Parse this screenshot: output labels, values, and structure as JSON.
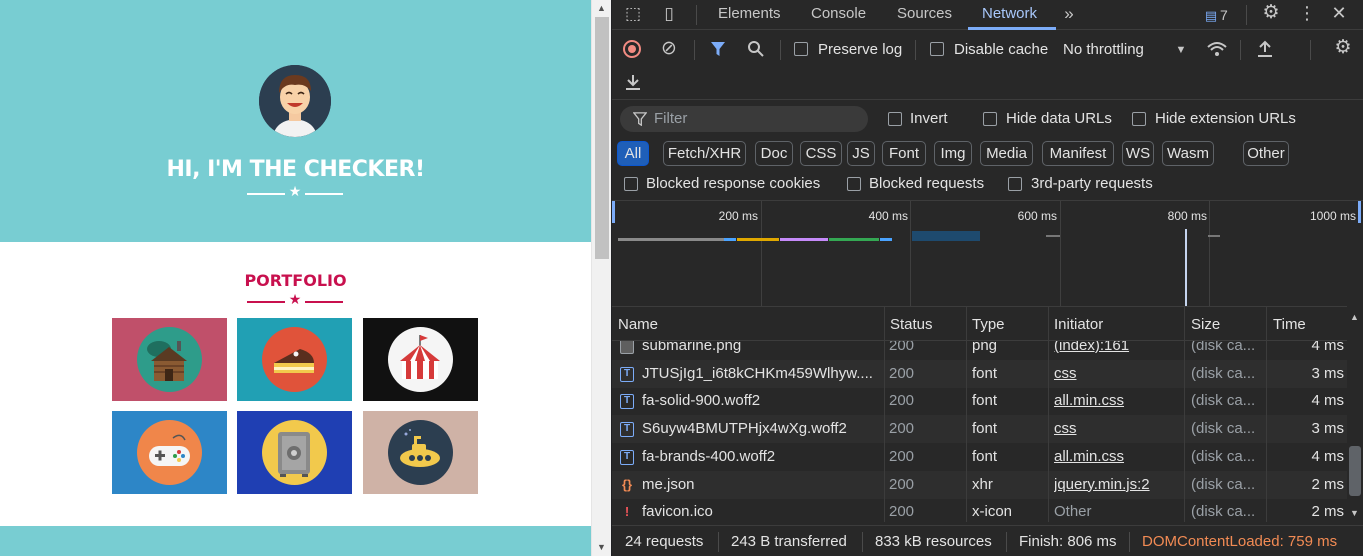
{
  "page": {
    "hero_title": "HI, I'M THE CHECKER!",
    "portfolio_title": "PORTFOLIO",
    "tiles": [
      {
        "name": "cabin",
        "bg": "#c0506a",
        "circle": "#2e9c8a"
      },
      {
        "name": "cake",
        "bg": "#21a0b4",
        "circle": "#e0533a"
      },
      {
        "name": "circus-tent",
        "bg": "#111111",
        "circle": "#f5f5f5"
      },
      {
        "name": "game-controller",
        "bg": "#2d86c7",
        "circle": "#f0864a"
      },
      {
        "name": "safe",
        "bg": "#1f3fb3",
        "circle": "#f2c94c"
      },
      {
        "name": "submarine",
        "bg": "#cfb2a6",
        "circle": "#2c3e50"
      }
    ],
    "colors": {
      "hero": "#78cdd2",
      "accent": "#c8104e"
    }
  },
  "devtools": {
    "tabs": [
      "Elements",
      "Console",
      "Sources",
      "Network"
    ],
    "active_tab": "Network",
    "issues_count": "7",
    "toolbar": {
      "preserve_log": "Preserve log",
      "disable_cache": "Disable cache",
      "throttling": "No throttling"
    },
    "filter": {
      "placeholder": "Filter",
      "invert": "Invert",
      "hide_data_urls": "Hide data URLs",
      "hide_extension_urls": "Hide extension URLs"
    },
    "type_chips": [
      "All",
      "Fetch/XHR",
      "Doc",
      "CSS",
      "JS",
      "Font",
      "Img",
      "Media",
      "Manifest",
      "WS",
      "Wasm",
      "Other"
    ],
    "active_chip": "All",
    "blocked": {
      "cookies": "Blocked response cookies",
      "requests": "Blocked requests",
      "third_party": "3rd-party requests"
    },
    "timeline_labels": [
      "200 ms",
      "400 ms",
      "600 ms",
      "800 ms",
      "1000 ms"
    ],
    "columns": [
      "Name",
      "Status",
      "Type",
      "Initiator",
      "Size",
      "Time"
    ],
    "rows": [
      {
        "name": "submarine.png",
        "status": "200",
        "type": "png",
        "initiator": "(index):161",
        "size": "(disk ca...",
        "time": "4 ms",
        "icon": "img"
      },
      {
        "name": "JTUSjIg1_i6t8kCHKm459Wlhyw....",
        "status": "200",
        "type": "font",
        "initiator": "css",
        "size": "(disk ca...",
        "time": "3 ms",
        "icon": "font"
      },
      {
        "name": "fa-solid-900.woff2",
        "status": "200",
        "type": "font",
        "initiator": "all.min.css",
        "size": "(disk ca...",
        "time": "4 ms",
        "icon": "font"
      },
      {
        "name": "S6uyw4BMUTPHjx4wXg.woff2",
        "status": "200",
        "type": "font",
        "initiator": "css",
        "size": "(disk ca...",
        "time": "3 ms",
        "icon": "font"
      },
      {
        "name": "fa-brands-400.woff2",
        "status": "200",
        "type": "font",
        "initiator": "all.min.css",
        "size": "(disk ca...",
        "time": "4 ms",
        "icon": "font"
      },
      {
        "name": "me.json",
        "status": "200",
        "type": "xhr",
        "initiator": "jquery.min.js:2",
        "size": "(disk ca...",
        "time": "2 ms",
        "icon": "json"
      },
      {
        "name": "favicon.ico",
        "status": "200",
        "type": "x-icon",
        "initiator": "Other",
        "size": "(disk ca...",
        "time": "2 ms",
        "icon": "ico"
      }
    ],
    "status": {
      "requests": "24 requests",
      "transferred": "243 B transferred",
      "resources": "833 kB resources",
      "finish": "Finish: 806 ms",
      "dcl": "DOMContentLoaded: 759 ms"
    }
  }
}
